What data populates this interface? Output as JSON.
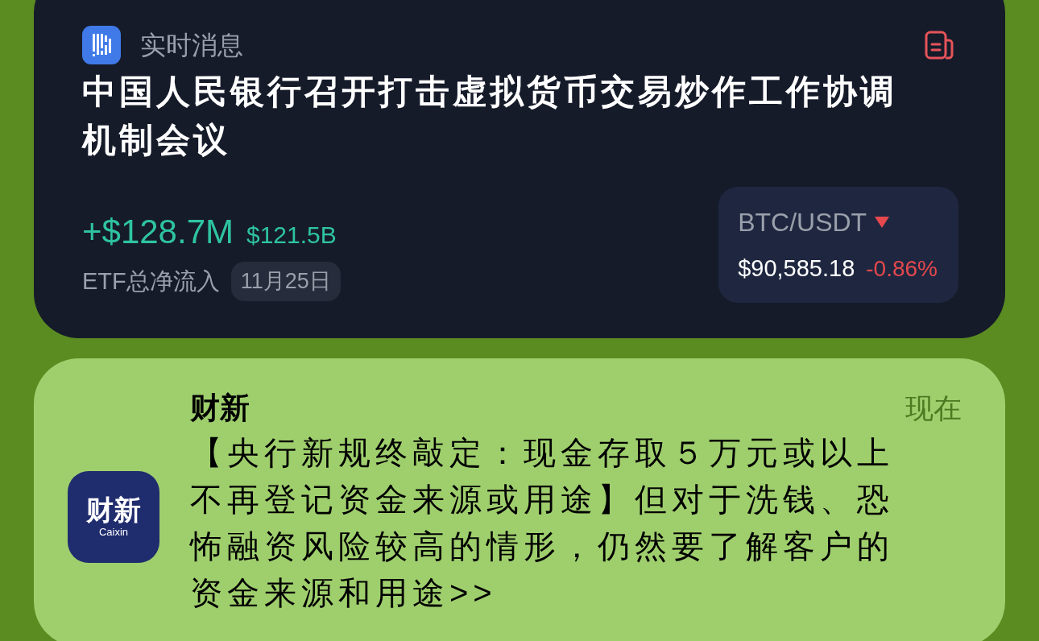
{
  "widget": {
    "app_name": "实时消息",
    "headline": "中国人民银行召开打击虚拟货币交易炒作工作协调机制会议",
    "etf": {
      "flow": "+$128.7M",
      "total": "$121.5B",
      "label": "ETF总净流入",
      "date": "11月25日"
    },
    "ticker": {
      "pair": "BTC/USDT",
      "down": true,
      "price": "$90,585.18",
      "change": "-0.86%"
    }
  },
  "notification": {
    "app_name": "财新",
    "time": "现在",
    "logo_text": "财新",
    "logo_subtext": "Caixin",
    "body": "【央行新规终敲定：现金存取５万元或以上不再登记资金来源或用途】但对于洗钱、恐怖融资风险较高的情形，仍然要了解客户的资金来源和用途>>"
  }
}
